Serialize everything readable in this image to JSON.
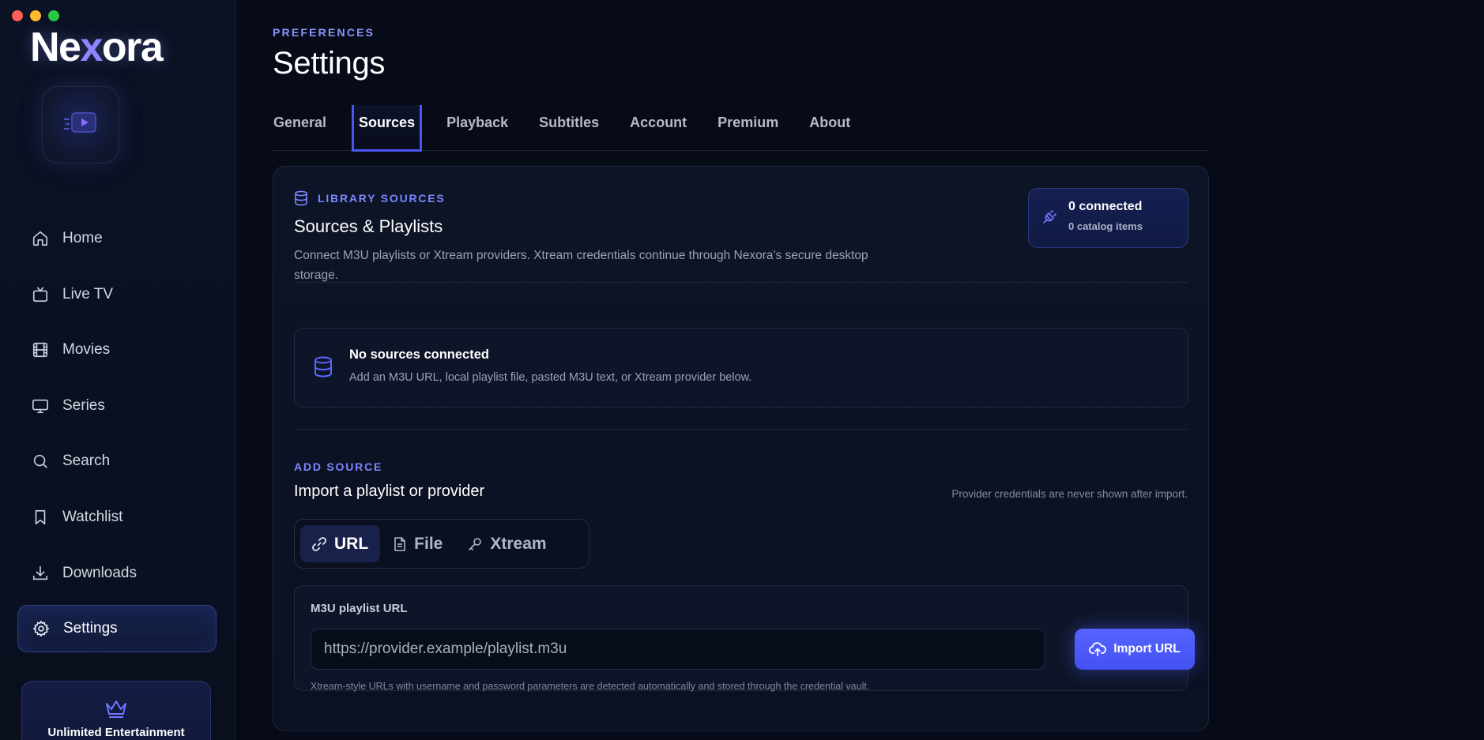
{
  "window": {
    "traffic_lights": [
      "#ff5f57",
      "#febc2e",
      "#28c840"
    ]
  },
  "brand": {
    "name_start": "Ne",
    "name_x": "x",
    "name_end": "ora",
    "accent": "#8f86ff"
  },
  "sidebar": {
    "items": [
      {
        "label": "Home",
        "icon": "home-icon"
      },
      {
        "label": "Live TV",
        "icon": "tv-icon"
      },
      {
        "label": "Movies",
        "icon": "film-icon"
      },
      {
        "label": "Series",
        "icon": "monitor-icon"
      },
      {
        "label": "Search",
        "icon": "search-icon"
      },
      {
        "label": "Watchlist",
        "icon": "bookmark-icon"
      },
      {
        "label": "Downloads",
        "icon": "download-icon"
      },
      {
        "label": "Settings",
        "icon": "gear-icon",
        "active": true
      }
    ],
    "promo_title": "Unlimited Entertainment"
  },
  "header": {
    "eyebrow": "PREFERENCES",
    "title": "Settings"
  },
  "tabs": [
    {
      "label": "General"
    },
    {
      "label": "Sources",
      "active": true
    },
    {
      "label": "Playback"
    },
    {
      "label": "Subtitles"
    },
    {
      "label": "Account"
    },
    {
      "label": "Premium"
    },
    {
      "label": "About"
    }
  ],
  "library": {
    "eyebrow": "LIBRARY SOURCES",
    "title": "Sources & Playlists",
    "description_line1": "Connect M3U playlists or Xtream providers. Xtream credentials continue through Nexora's secure desktop",
    "description_line2": "storage.",
    "status": {
      "connected": "0 connected",
      "catalog": "0 catalog items"
    },
    "empty": {
      "title": "No sources connected",
      "text": "Add an M3U URL, local playlist file, pasted M3U text, or Xtream provider below."
    }
  },
  "add_source": {
    "eyebrow": "ADD SOURCE",
    "title": "Import a playlist or provider",
    "hint": "Provider credentials are never shown after import.",
    "modes": [
      {
        "label": "URL",
        "icon": "link-icon",
        "active": true
      },
      {
        "label": "File",
        "icon": "file-icon"
      },
      {
        "label": "Xtream",
        "icon": "key-icon"
      }
    ],
    "url_field": {
      "label": "M3U playlist URL",
      "placeholder": "https://provider.example/playlist.m3u",
      "value": "",
      "button": "Import URL",
      "hint": "Xtream-style URLs with username and password parameters are detected automatically and stored through the credential vault."
    }
  },
  "colors": {
    "accent": "#4b55f0",
    "button": "#5663ff",
    "background": "#070b17"
  }
}
